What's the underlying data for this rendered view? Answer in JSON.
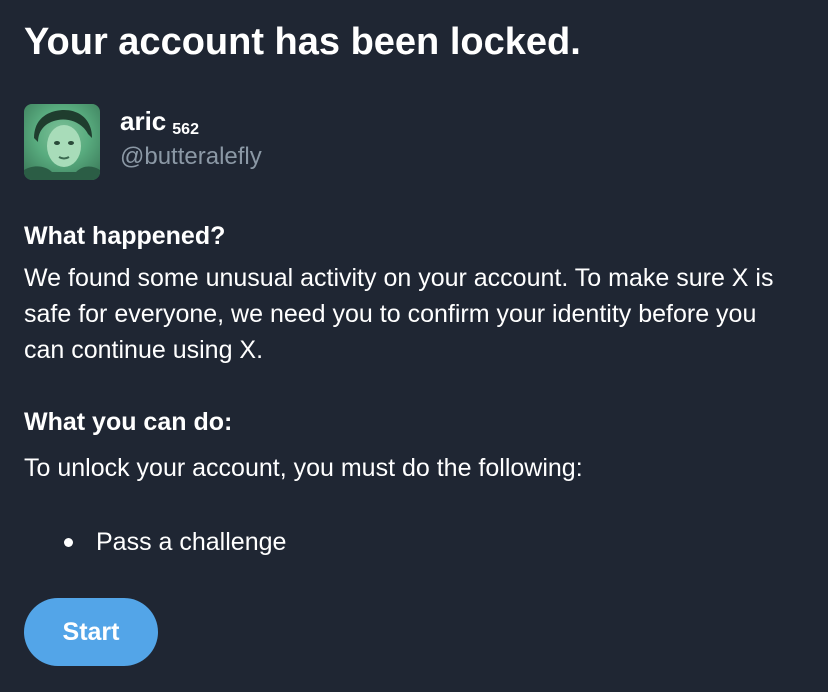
{
  "page": {
    "title": "Your account has been locked."
  },
  "user": {
    "name": "aric",
    "count": "562",
    "handle": "@butteralefly"
  },
  "sections": {
    "what_happened": {
      "heading": "What happened?",
      "body": "We found some unusual activity on your account. To make sure X is safe for everyone, we need you to confirm your identity before you can continue using X."
    },
    "what_you_can_do": {
      "heading": "What you can do:",
      "body": "To unlock your account, you must do the following:",
      "steps": [
        "Pass a challenge"
      ]
    }
  },
  "actions": {
    "start_label": "Start"
  },
  "colors": {
    "background": "#1f2633",
    "text": "#ffffff",
    "muted_text": "#8b98a5",
    "button": "#53a5e8",
    "avatar_tint": "#5fb587"
  }
}
